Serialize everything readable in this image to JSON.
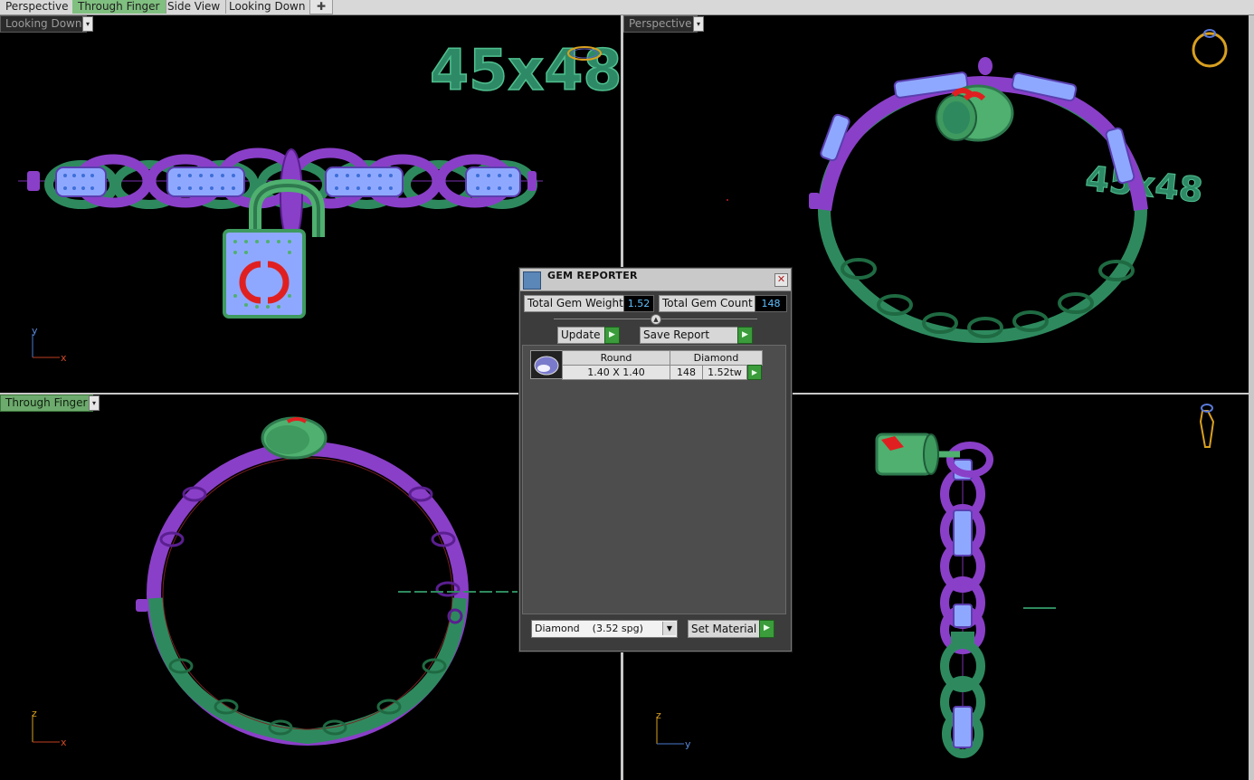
{
  "tabs": [
    {
      "label": "Perspective"
    },
    {
      "label": "Through Finger"
    },
    {
      "label": "Side View"
    },
    {
      "label": "Looking Down"
    }
  ],
  "viewports": {
    "top_left": {
      "label": "Looking Down",
      "size_text": "45x48",
      "axis_v": "y",
      "axis_h": "x"
    },
    "top_right": {
      "label": "Perspective",
      "size_text": "45x48"
    },
    "bottom_left": {
      "label": "Through Finger",
      "axis_v": "z",
      "axis_h": "x"
    },
    "bottom_right": {
      "axis_v": "z",
      "axis_h": "y"
    }
  },
  "gem_reporter": {
    "title": "GEM REPORTER",
    "total_weight_label": "Total Gem Weight",
    "total_weight_value": "1.52",
    "total_count_label": "Total Gem Count",
    "total_count_value": "148",
    "update_label": "Update",
    "save_report_label": "Save Report",
    "table": {
      "shape": "Round",
      "material": "Diamond",
      "size": "1.40 X 1.40",
      "count": "148",
      "weight": "1.52tw"
    },
    "material_select": "Diamond    (3.52 spg)",
    "set_material_label": "Set Material"
  },
  "colors": {
    "accent_green": "#3a9c3a",
    "tab_active": "#7fbf7f",
    "purple_metal": "#9b3fd0",
    "green_metal": "#2e8a5e",
    "gem_blue": "#8fa8ff",
    "logo_red": "#e02020"
  }
}
